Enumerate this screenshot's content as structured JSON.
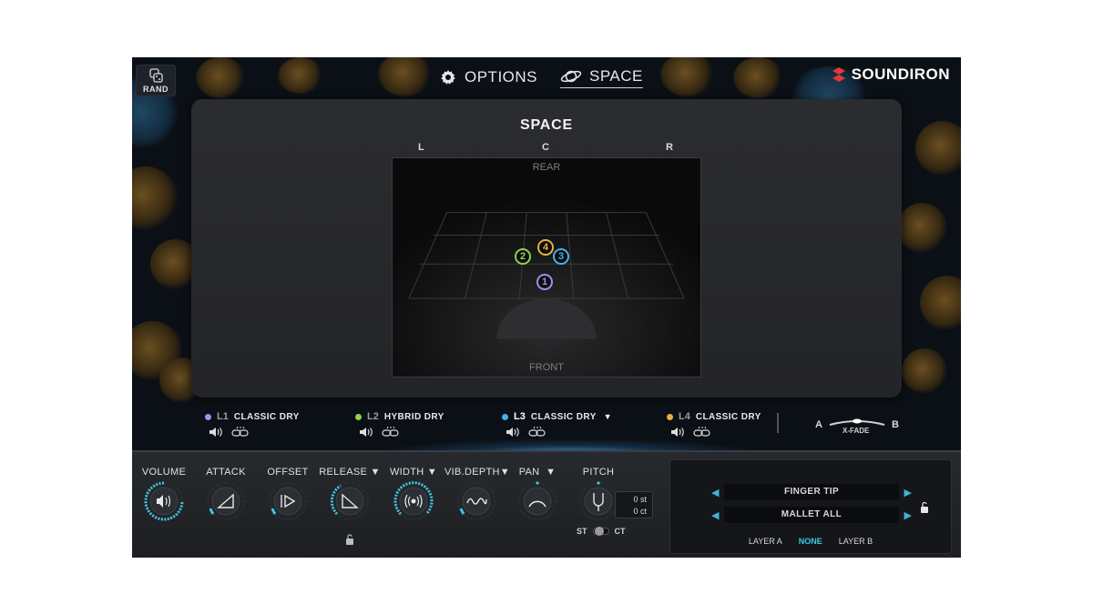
{
  "top_bar": {
    "rand_label": "RAND",
    "options_label": "OPTIONS",
    "space_label": "SPACE",
    "brand": "SOUNDIRON"
  },
  "space": {
    "title": "SPACE",
    "left": "L",
    "center": "C",
    "right": "R",
    "rear": "REAR",
    "front": "FRONT",
    "markers": [
      {
        "label": "1",
        "color": "#a58df2"
      },
      {
        "label": "2",
        "color": "#8fd24d"
      },
      {
        "label": "3",
        "color": "#43b2e8"
      },
      {
        "label": "4",
        "color": "#e8b23a"
      }
    ]
  },
  "layers": [
    {
      "id": "L1",
      "name": "CLASSIC DRY",
      "color": "#a58df2",
      "has_menu": false
    },
    {
      "id": "L2",
      "name": "HYBRID DRY",
      "color": "#8fd24d",
      "has_menu": false
    },
    {
      "id": "L3",
      "name": "CLASSIC DRY",
      "color": "#43b2e8",
      "has_menu": true
    },
    {
      "id": "L4",
      "name": "CLASSIC DRY",
      "color": "#e8b23a",
      "has_menu": false
    }
  ],
  "xfade": {
    "a": "A",
    "b": "B",
    "label": "X-FADE"
  },
  "controls": {
    "volume": "VOLUME",
    "attack": "ATTACK",
    "offset": "OFFSET",
    "release": "RELEASE",
    "width": "WIDTH",
    "vib_depth": "VIB.DEPTH",
    "pan": "PAN",
    "pitch": "PITCH",
    "pitch_st": "0 st",
    "pitch_ct": "0 ct",
    "st": "ST",
    "ct": "CT",
    "dropdown_arrow": "▼"
  },
  "articulation": {
    "row1": "FINGER TIP",
    "row2": "MALLET ALL",
    "layer_a": "LAYER A",
    "none": "NONE",
    "layer_b": "LAYER B",
    "arrow_left": "◀",
    "arrow_right": "▶"
  },
  "accent_color": "#3fc6e8"
}
